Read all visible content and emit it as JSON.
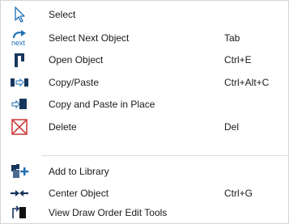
{
  "menu": {
    "items": [
      {
        "label": "Select",
        "shortcut": "",
        "icon": "select-arrow-icon"
      },
      {
        "label": "Select Next Object",
        "shortcut": "Tab",
        "icon": "select-next-icon",
        "icon_text": "next"
      },
      {
        "label": "Open Object",
        "shortcut": "Ctrl+E",
        "icon": "open-object-icon"
      },
      {
        "label": "Copy/Paste",
        "shortcut": "Ctrl+Alt+C",
        "icon": "copy-paste-icon"
      },
      {
        "label": "Copy and Paste in Place",
        "shortcut": "",
        "icon": "copy-paste-in-place-icon"
      },
      {
        "label": "Delete",
        "shortcut": "Del",
        "icon": "delete-icon"
      },
      {
        "label": "Add to Library",
        "shortcut": "",
        "icon": "add-to-library-icon"
      },
      {
        "label": "Center Object",
        "shortcut": "Ctrl+G",
        "icon": "center-object-icon"
      },
      {
        "label": "View Draw Order Edit Tools",
        "shortcut": "",
        "icon": "draw-order-icon"
      }
    ]
  },
  "colors": {
    "accent_blue": "#1e6fb4",
    "dark_navy": "#17365d",
    "delete_red": "#d04040",
    "text": "#1a1a1a",
    "separator": "#dcdcdc"
  }
}
